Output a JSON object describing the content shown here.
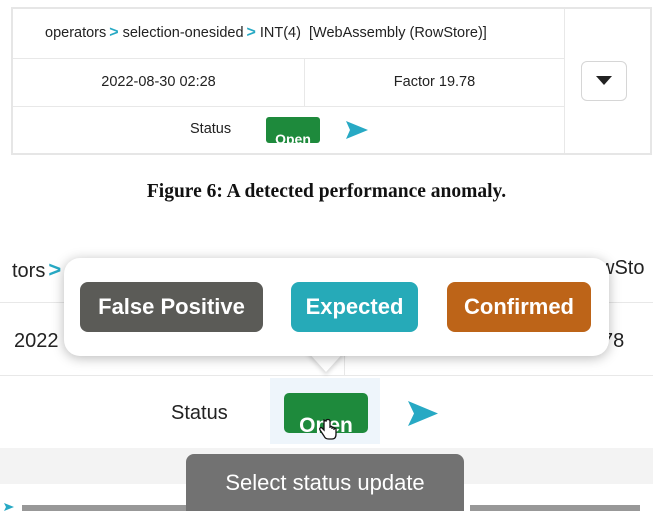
{
  "top_card": {
    "breadcrumb": [
      "operators",
      "selection-onesided",
      "INT(4)"
    ],
    "breadcrumb_tail": "[WebAssembly (RowStore)]",
    "timestamp": "2022-08-30 02:28",
    "factor": "Factor  19.78",
    "status_label": "Status",
    "status_value": "Open"
  },
  "caption": "Figure 6: A detected performance anomaly.",
  "zoomed": {
    "breadcrumb_start": "tors",
    "breadcrumb_end_fragment": "wSto",
    "row2_left_fragment": "2022",
    "row2_right_fragment": "78",
    "status_label": "Status",
    "status_value": "Open",
    "popup_options": [
      {
        "label": "False Positive",
        "color": "#5b5b57"
      },
      {
        "label": "Expected",
        "color": "#26aab8"
      },
      {
        "label": "Confirmed",
        "color": "#bd6418"
      }
    ],
    "tooltip": "Select status update"
  },
  "colors": {
    "status_open": "#1e8a3c",
    "chevron": "#27a9c4",
    "send_arrow": "#27a9c4"
  },
  "icons": [
    "chevron-right-icon",
    "caret-down-icon",
    "send-arrow-icon",
    "hand-cursor-icon"
  ]
}
